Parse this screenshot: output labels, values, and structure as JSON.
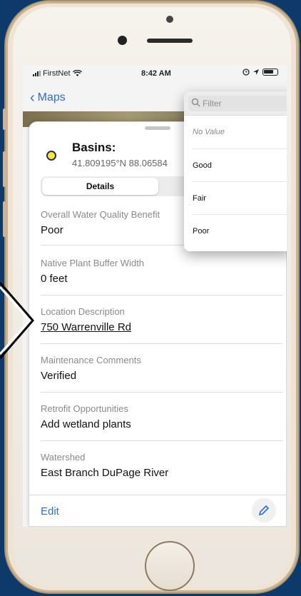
{
  "status_bar": {
    "carrier": "FirstNet",
    "time": "8:42 AM"
  },
  "nav": {
    "back_label": "Maps"
  },
  "feature": {
    "title": "Basins:",
    "coordinates": "41.809195°N 88.06584",
    "dot_color": "#f3e54a"
  },
  "tabs": [
    {
      "label": "Details",
      "active": true
    },
    {
      "label": "",
      "active": false
    }
  ],
  "attributes": [
    {
      "label": "Overall Water Quality Benefit",
      "value": "Poor"
    },
    {
      "label": "Native Plant Buffer Width",
      "value": "0 feet"
    },
    {
      "label": "Location Description",
      "value": "750 Warrenville Rd"
    },
    {
      "label": "Maintenance Comments",
      "value": "Verified"
    },
    {
      "label": "Retrofit Opportunities",
      "value": "Add wetland plants"
    },
    {
      "label": "Watershed",
      "value": "East Branch DuPage River"
    }
  ],
  "footer": {
    "edit_label": "Edit"
  },
  "dropdown": {
    "filter_placeholder": "Filter",
    "options": [
      "No Value",
      "Good",
      "Fair",
      "Poor"
    ]
  },
  "colors": {
    "accent": "#2b6fd6",
    "background": "#0d3a6b"
  }
}
